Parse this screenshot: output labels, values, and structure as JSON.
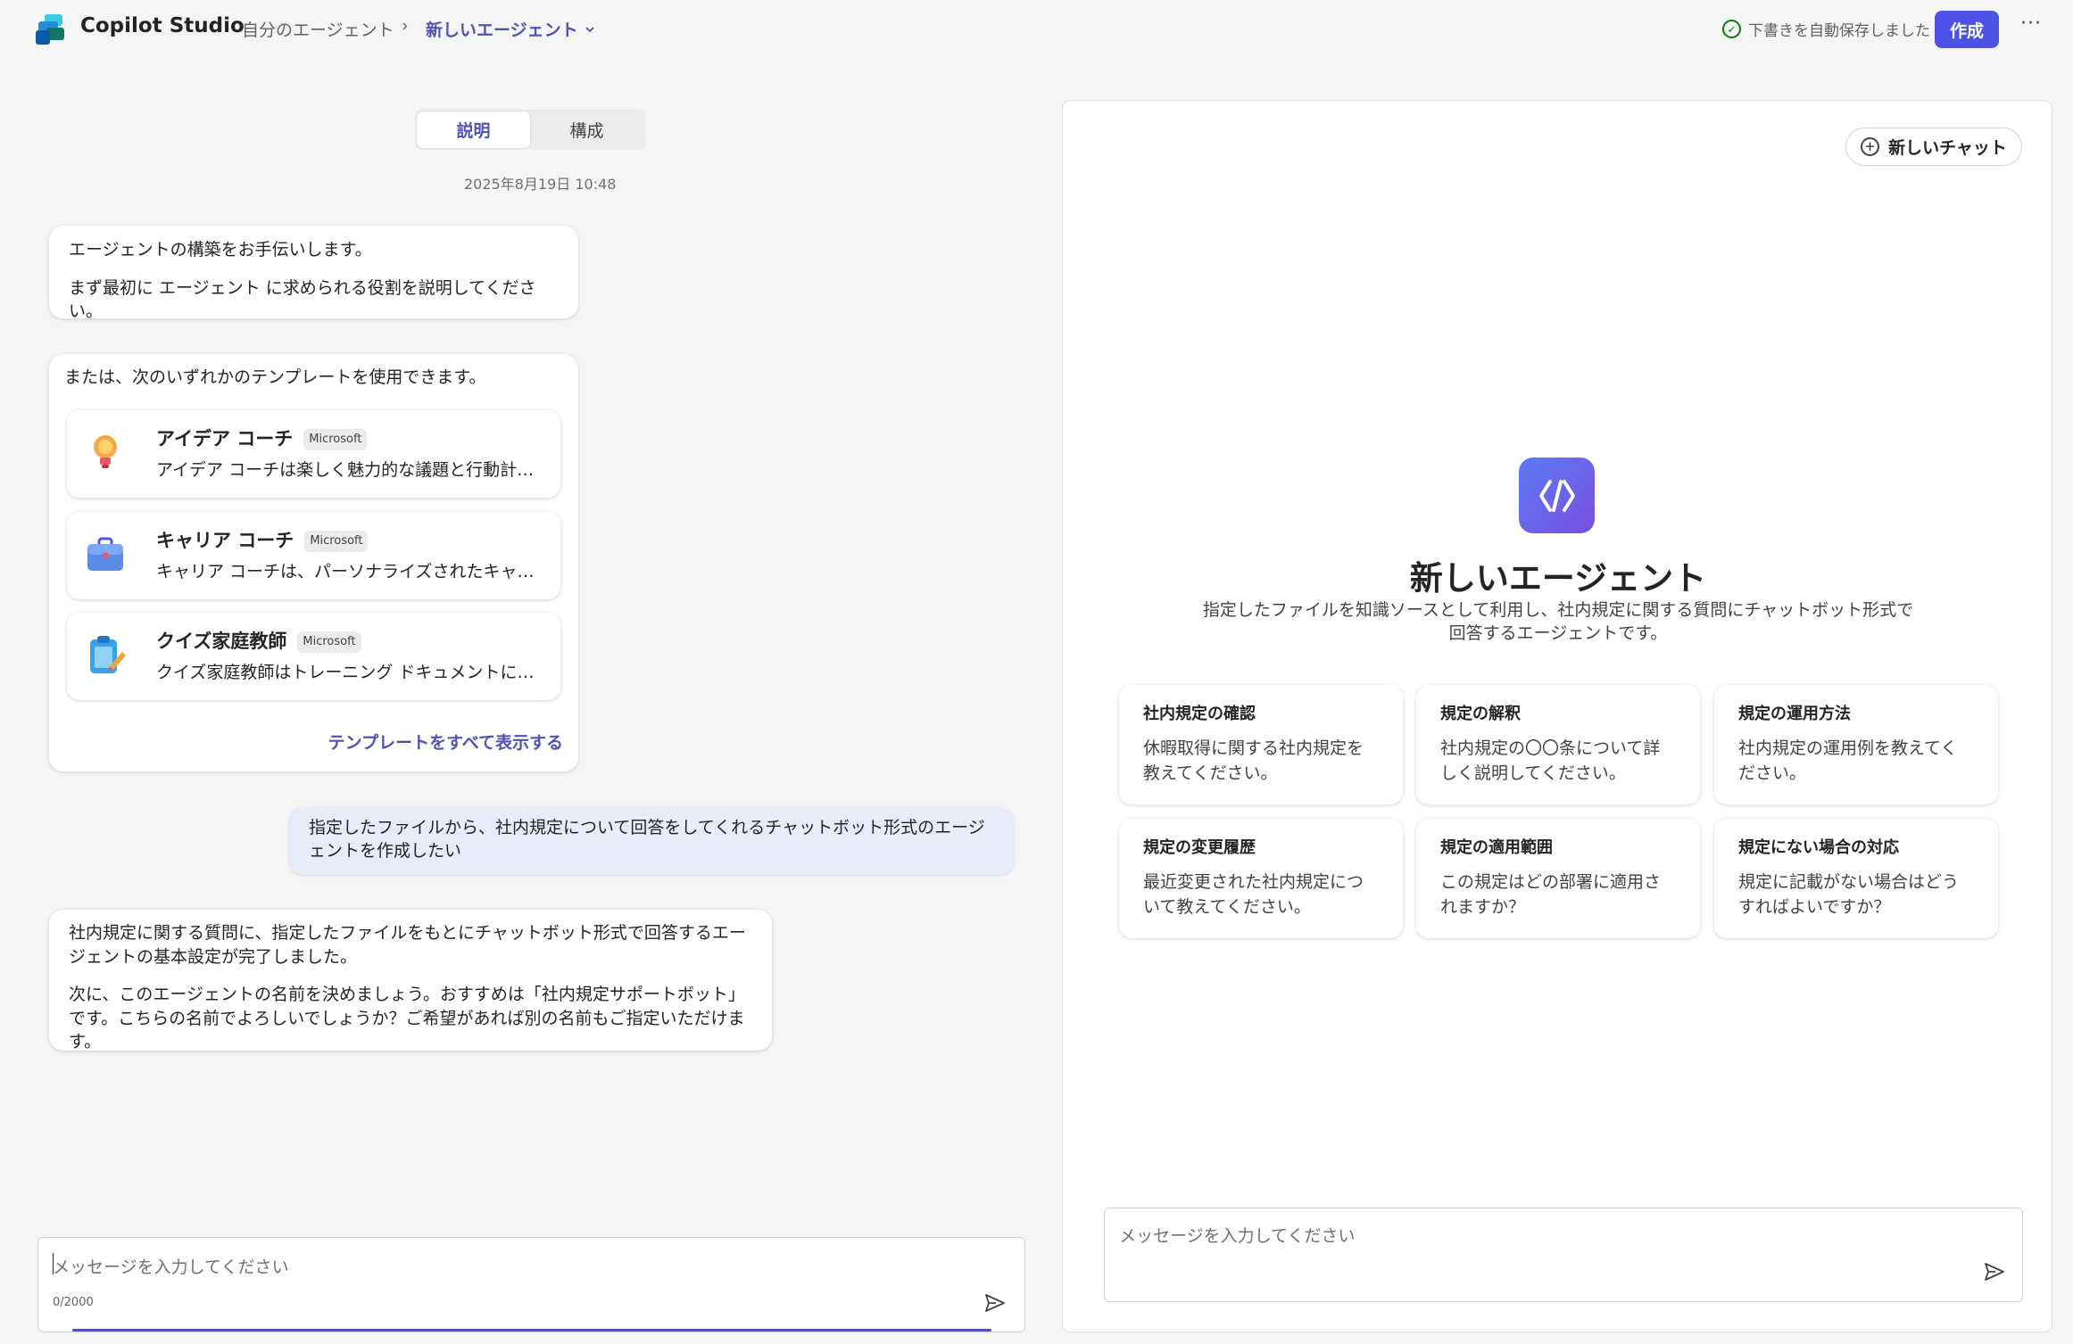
{
  "header": {
    "app_title": "Copilot Studio",
    "breadcrumb_root": "自分のエージェント",
    "breadcrumb_sep": "›",
    "breadcrumb_current": "新しいエージェント",
    "autosave_status": "下書きを自動保存しました",
    "create_label": "作成",
    "more_label": "···"
  },
  "left": {
    "tabs": [
      {
        "label": "説明",
        "active": true
      },
      {
        "label": "構成",
        "active": false
      }
    ],
    "timestamp": "2025年8月19日 10:48",
    "intro_msg": {
      "line1": "エージェントの構築をお手伝いします。",
      "line2": "まず最初に エージェント に求められる役割を説明してください。"
    },
    "templates_msg": {
      "intro": "または、次のいずれかのテンプレートを使用できます。",
      "templates": [
        {
          "name": "アイデア コーチ",
          "badge": "Microsoft",
          "desc": "アイデア コーチは楽しく魅力的な議題と行動計画を作成します",
          "icon": "lightbulb-icon"
        },
        {
          "name": "キャリア コーチ",
          "badge": "Microsoft",
          "desc": "キャリア コーチは、パーソナライズされたキャリア アドバイスを提供します",
          "icon": "briefcase-icon"
        },
        {
          "name": "クイズ家庭教師",
          "badge": "Microsoft",
          "desc": "クイズ家庭教師はトレーニング ドキュメントに基づいてクイズを作成します",
          "icon": "clipboard-icon"
        }
      ],
      "show_all": "テンプレートをすべて表示する"
    },
    "user_msg": "指定したファイルから、社内規定について回答をしてくれるチャットボット形式のエージェントを作成したい",
    "reply_msg": {
      "p1": "社内規定に関する質問に、指定したファイルをもとにチャットボット形式で回答するエージェントの基本設定が完了しました。",
      "p2": "次に、このエージェントの名前を決めましょう。おすすめは「社内規定サポートボット」です。こちらの名前でよろしいでしょうか？ご希望があれば別の名前もご指定いただけます。"
    },
    "input": {
      "placeholder": "メッセージを入力してください",
      "counter": "0/2000"
    }
  },
  "preview": {
    "new_chat_label": "新しいチャット",
    "agent_title": "新しいエージェント",
    "agent_desc": "指定したファイルを知識ソースとして利用し、社内規定に関する質問にチャットボット形式で回答するエージェントです。",
    "starters": [
      {
        "title": "社内規定の確認",
        "desc": "休暇取得に関する社内規定を教えてください。"
      },
      {
        "title": "規定の解釈",
        "desc": "社内規定の〇〇条について詳しく説明してください。"
      },
      {
        "title": "規定の運用方法",
        "desc": "社内規定の運用例を教えてください。"
      },
      {
        "title": "規定の変更履歴",
        "desc": "最近変更された社内規定について教えてください。"
      },
      {
        "title": "規定の適用範囲",
        "desc": "この規定はどの部署に適用されますか？"
      },
      {
        "title": "規定にない場合の対応",
        "desc": "規定に記載がない場合はどうすればよいですか？"
      }
    ],
    "input_placeholder": "メッセージを入力してください"
  },
  "colors": {
    "accent": "#4f52b2",
    "create_button": "#4f52e6",
    "user_bubble": "#e8ebfa",
    "success": "#0e7a0d"
  }
}
